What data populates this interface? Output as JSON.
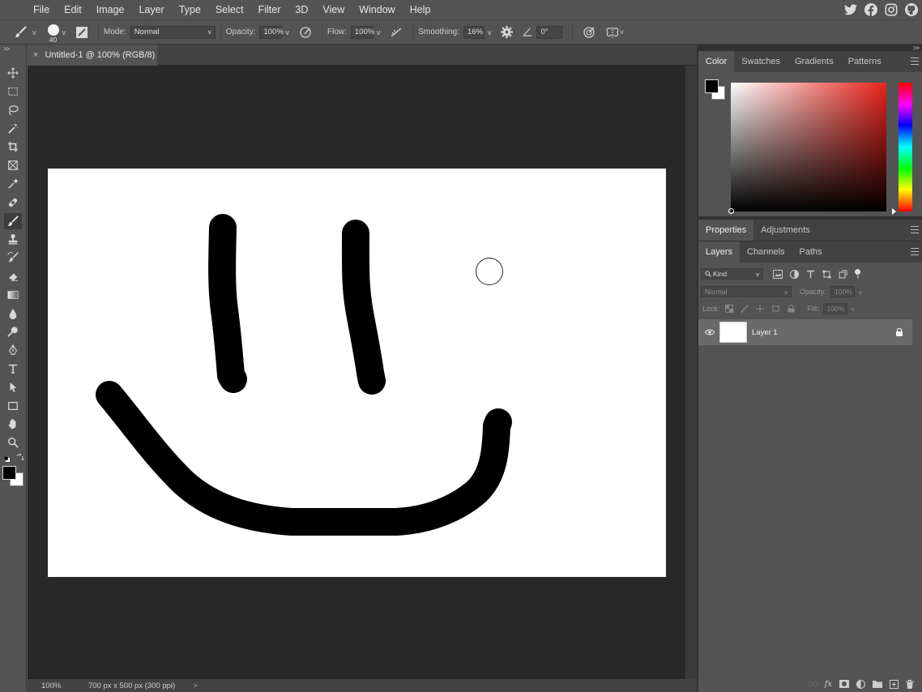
{
  "menu": [
    "File",
    "Edit",
    "Image",
    "Layer",
    "Type",
    "Select",
    "Filter",
    "3D",
    "View",
    "Window",
    "Help"
  ],
  "social_icons": [
    "twitter-icon",
    "facebook-icon",
    "instagram-icon",
    "github-icon"
  ],
  "options": {
    "brush_size": "40",
    "mode_label": "Mode:",
    "mode_value": "Normal",
    "opacity_label": "Opacity:",
    "opacity_value": "100%",
    "flow_label": "Flow:",
    "flow_value": "100%",
    "smoothing_label": "Smoothing:",
    "smoothing_value": "16%",
    "angle_value": "0°"
  },
  "toolbar": {
    "collapse": ">>",
    "tools": [
      "move-tool",
      "marquee-tool",
      "lasso-tool",
      "magic-wand-tool",
      "crop-tool",
      "frame-tool",
      "eyedropper-tool",
      "healing-tool",
      "brush-tool",
      "stamp-tool",
      "history-brush-tool",
      "eraser-tool",
      "gradient-tool",
      "blur-tool",
      "dodge-tool",
      "pen-tool",
      "type-tool",
      "path-select-tool",
      "rectangle-tool",
      "hand-tool",
      "zoom-tool"
    ],
    "active_tool": "brush-tool"
  },
  "document": {
    "close": "×",
    "tab_title": "Untitled-1 @ 100% (RGB/8)"
  },
  "status": {
    "zoom": "100%",
    "doc_info": "700 px x 500 px (300 ppi)",
    "arrow": ">"
  },
  "color_panel": {
    "collapse": ">>",
    "tabs": [
      "Color",
      "Swatches",
      "Gradients",
      "Patterns"
    ],
    "active_tab": "Color",
    "foreground": "#000000",
    "background": "#ffffff",
    "hue_color": "#e8231a"
  },
  "properties_panel": {
    "tabs": [
      "Properties",
      "Adjustments"
    ]
  },
  "layers_panel": {
    "tabs": [
      "Layers",
      "Channels",
      "Paths"
    ],
    "filter_label": "Kind",
    "blend_mode": "Normal",
    "opacity_label": "Opacity:",
    "opacity_value": "100%",
    "lock_label": "Lock:",
    "fill_label": "Fill:",
    "fill_value": "100%",
    "layers": [
      {
        "name": "Layer 1",
        "visible": true,
        "locked": true
      }
    ]
  }
}
